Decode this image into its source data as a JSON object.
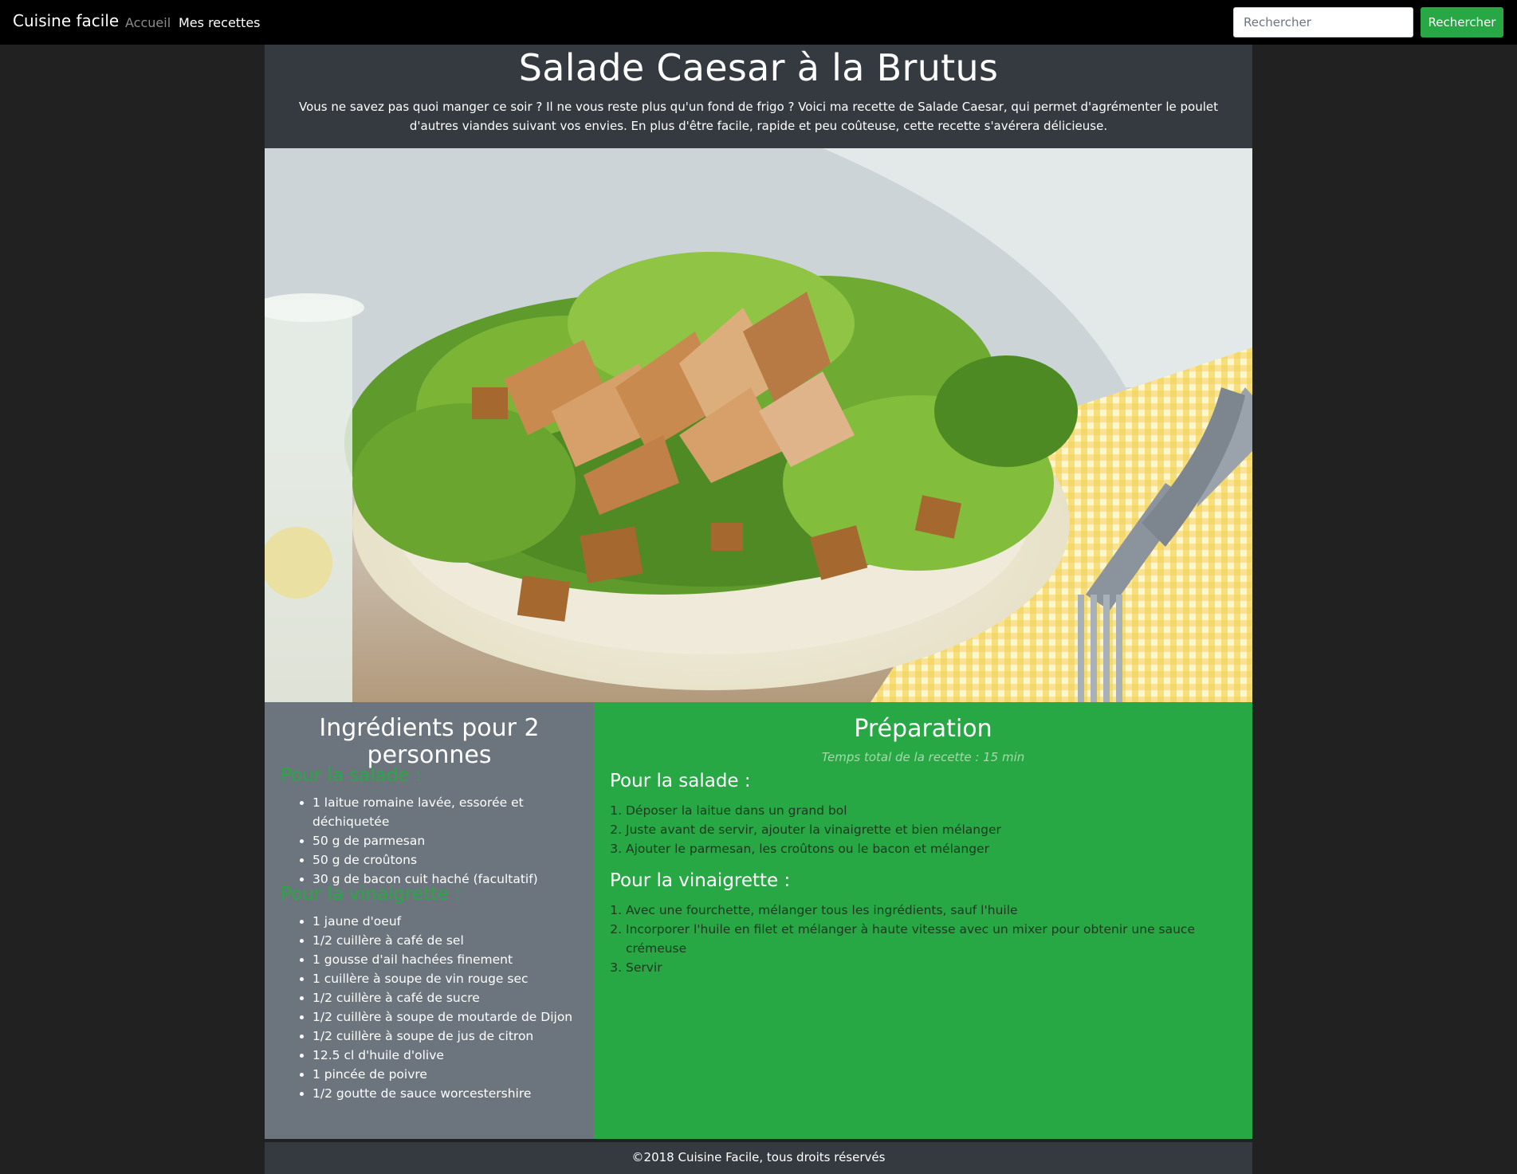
{
  "navbar": {
    "brand": "Cuisine facile",
    "links": [
      "Accueil",
      "Mes recettes"
    ],
    "search_placeholder": "Rechercher",
    "search_button": "Rechercher"
  },
  "recipe": {
    "title": "Salade Caesar à la Brutus",
    "intro": "Vous ne savez pas quoi manger ce soir ? Il ne vous reste plus qu'un fond de frigo ? Voici ma recette de Salade Caesar, qui permet d'agrémenter le poulet d'autres viandes suivant vos envies. En plus d'être facile, rapide et peu coûteuse, cette recette s'avérera délicieuse."
  },
  "ingredients": {
    "title": "Ingrédients pour 2 personnes",
    "salade_heading": "Pour la salade :",
    "salade_items": [
      "1 laitue romaine lavée, essorée et déchiquetée",
      "50 g de parmesan",
      "50 g de croûtons",
      "30 g de bacon cuit haché (facultatif)"
    ],
    "vinaigrette_heading": "Pour la vinaigrette :",
    "vinaigrette_items": [
      "1 jaune d'oeuf",
      "1/2 cuillère à café de sel",
      "1 gousse d'ail hachées finement",
      "1 cuillère à soupe de vin rouge sec",
      "1/2 cuillère à café de sucre",
      "1/2 cuillère à soupe de moutarde de Dijon",
      "1/2 cuillère à soupe de jus de citron",
      "12.5 cl d'huile d'olive",
      "1 pincée de poivre",
      "1/2 goutte de sauce worcestershire"
    ]
  },
  "preparation": {
    "title": "Préparation",
    "time": "Temps total de la recette : 15 min",
    "salade_heading": "Pour la salade :",
    "salade_steps": [
      "Déposer la laitue dans un grand bol",
      "Juste avant de servir, ajouter la vinaigrette et bien mélanger",
      "Ajouter le parmesan, les croûtons ou le bacon et mélanger"
    ],
    "vinaigrette_heading": "Pour la vinaigrette :",
    "vinaigrette_steps": [
      "Avec une fourchette, mélanger tous les ingrédients, sauf l'huile",
      "Incorporer l'huile en filet et mélanger à haute vitesse avec un mixer pour obtenir une sauce crémeuse",
      "Servir"
    ]
  },
  "footer": {
    "text": "©2018 Cuisine Facile, tous droits réservés"
  },
  "colors": {
    "navbar": "#000000",
    "header": "#343a40",
    "ingredients_bg": "#6c757d",
    "preparation_bg": "#28a745",
    "accent_green": "#28a745"
  }
}
